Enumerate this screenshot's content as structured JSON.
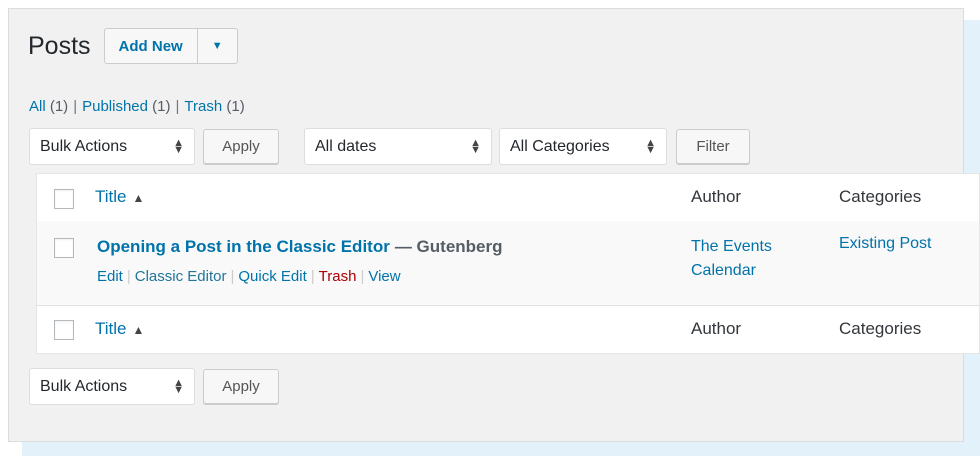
{
  "header": {
    "title": "Posts",
    "add_new_label": "Add New",
    "toggle_glyph": "▼"
  },
  "filters_links": {
    "all_label": "All",
    "all_count": "(1)",
    "published_label": "Published",
    "published_count": "(1)",
    "trash_label": "Trash",
    "trash_count": "(1)",
    "separator": "|"
  },
  "tablenav_top": {
    "bulk_actions": "Bulk Actions",
    "apply": "Apply",
    "dates": "All dates",
    "categories": "All Categories",
    "filter": "Filter"
  },
  "table": {
    "columns": {
      "title": "Title",
      "sort_indicator": "▲",
      "author": "Author",
      "categories": "Categories"
    },
    "rows": [
      {
        "title": "Opening a Post in the Classic Editor",
        "state": "— Gutenberg",
        "actions": {
          "edit": "Edit",
          "classic_editor": "Classic Editor",
          "quick_edit": "Quick Edit",
          "trash": "Trash",
          "view": "View"
        },
        "author_line1": "The Events",
        "author_line2": "Calendar",
        "category": "Existing Post"
      }
    ]
  },
  "tablenav_bottom": {
    "bulk_actions": "Bulk Actions",
    "apply": "Apply"
  },
  "colors": {
    "link": "#0073aa",
    "trash": "#aa0000",
    "panel_bg": "#f1f1f1",
    "shadow_bg": "#e3f1fb"
  }
}
